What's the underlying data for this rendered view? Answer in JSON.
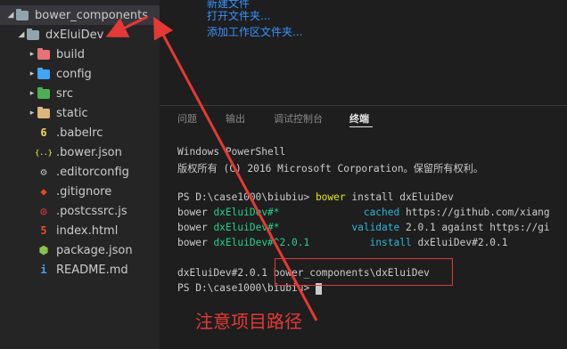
{
  "explorer": {
    "root_folder": "bower_components",
    "project_folder": "dxEluiDev",
    "items": [
      {
        "label": "build",
        "type": "folder",
        "icon": "build-folder-icon",
        "color": "#e57373"
      },
      {
        "label": "config",
        "type": "folder",
        "icon": "config-folder-icon",
        "color": "#42a5f5"
      },
      {
        "label": "src",
        "type": "folder",
        "icon": "src-folder-icon",
        "color": "#4caf50"
      },
      {
        "label": "static",
        "type": "folder",
        "icon": "folder-icon",
        "color": "#dcb67a"
      },
      {
        "label": ".babelrc",
        "type": "file",
        "icon": "babel-icon",
        "glyph": "6",
        "color": "#f5da55"
      },
      {
        "label": ".bower.json",
        "type": "file",
        "icon": "json-icon",
        "glyph": "{..}",
        "color": "#cbcb41"
      },
      {
        "label": ".editorconfig",
        "type": "file",
        "icon": "editorconfig-icon",
        "glyph": "⚙",
        "color": "#bbbbbb"
      },
      {
        "label": ".gitignore",
        "type": "file",
        "icon": "git-icon",
        "glyph": "◆",
        "color": "#e64a19"
      },
      {
        "label": ".postcssrc.js",
        "type": "file",
        "icon": "postcss-icon",
        "glyph": "◎",
        "color": "#dd3735"
      },
      {
        "label": "index.html",
        "type": "file",
        "icon": "html-icon",
        "glyph": "5",
        "color": "#e44d26"
      },
      {
        "label": "package.json",
        "type": "file",
        "icon": "npm-icon",
        "glyph": "⬢",
        "color": "#8bc34a"
      },
      {
        "label": "README.md",
        "type": "file",
        "icon": "info-icon",
        "glyph": "i",
        "color": "#42a5f5"
      }
    ]
  },
  "welcome": {
    "links": [
      "新建文件",
      "打开文件夹...",
      "添加工作区文件夹..."
    ]
  },
  "panel": {
    "tabs": [
      "问题",
      "输出",
      "调试控制台",
      "终端"
    ],
    "active_tab": "终端"
  },
  "terminal": {
    "banner_line1": "Windows PowerShell",
    "banner_line2": "版权所有 (C) 2016 Microsoft Corporation。保留所有权利。",
    "prompt": "PS D:\\case1000\\biubiu>",
    "command": "bower",
    "command_args": "install dxEluiDev",
    "out1": {
      "tool": "bower",
      "pkg": "dxEluiDev#*",
      "action": "cached",
      "detail": "https://github.com/xiang"
    },
    "out2": {
      "tool": "bower",
      "pkg": "dxEluiDev#*",
      "action": "validate",
      "detail": "2.0.1 against https://gi"
    },
    "out3": {
      "tool": "bower",
      "pkg": "dxEluiDev#^2.0.1",
      "action": "install",
      "detail": "dxEluiDev#2.0.1"
    },
    "result_pkg": "dxEluiDev#2.0.1",
    "result_path": "bower_components\\dxEluiDev",
    "prompt2": "PS D:\\case1000\\biubiu>"
  },
  "annotation": {
    "note": "注意项目路径",
    "color": "#e53935"
  }
}
